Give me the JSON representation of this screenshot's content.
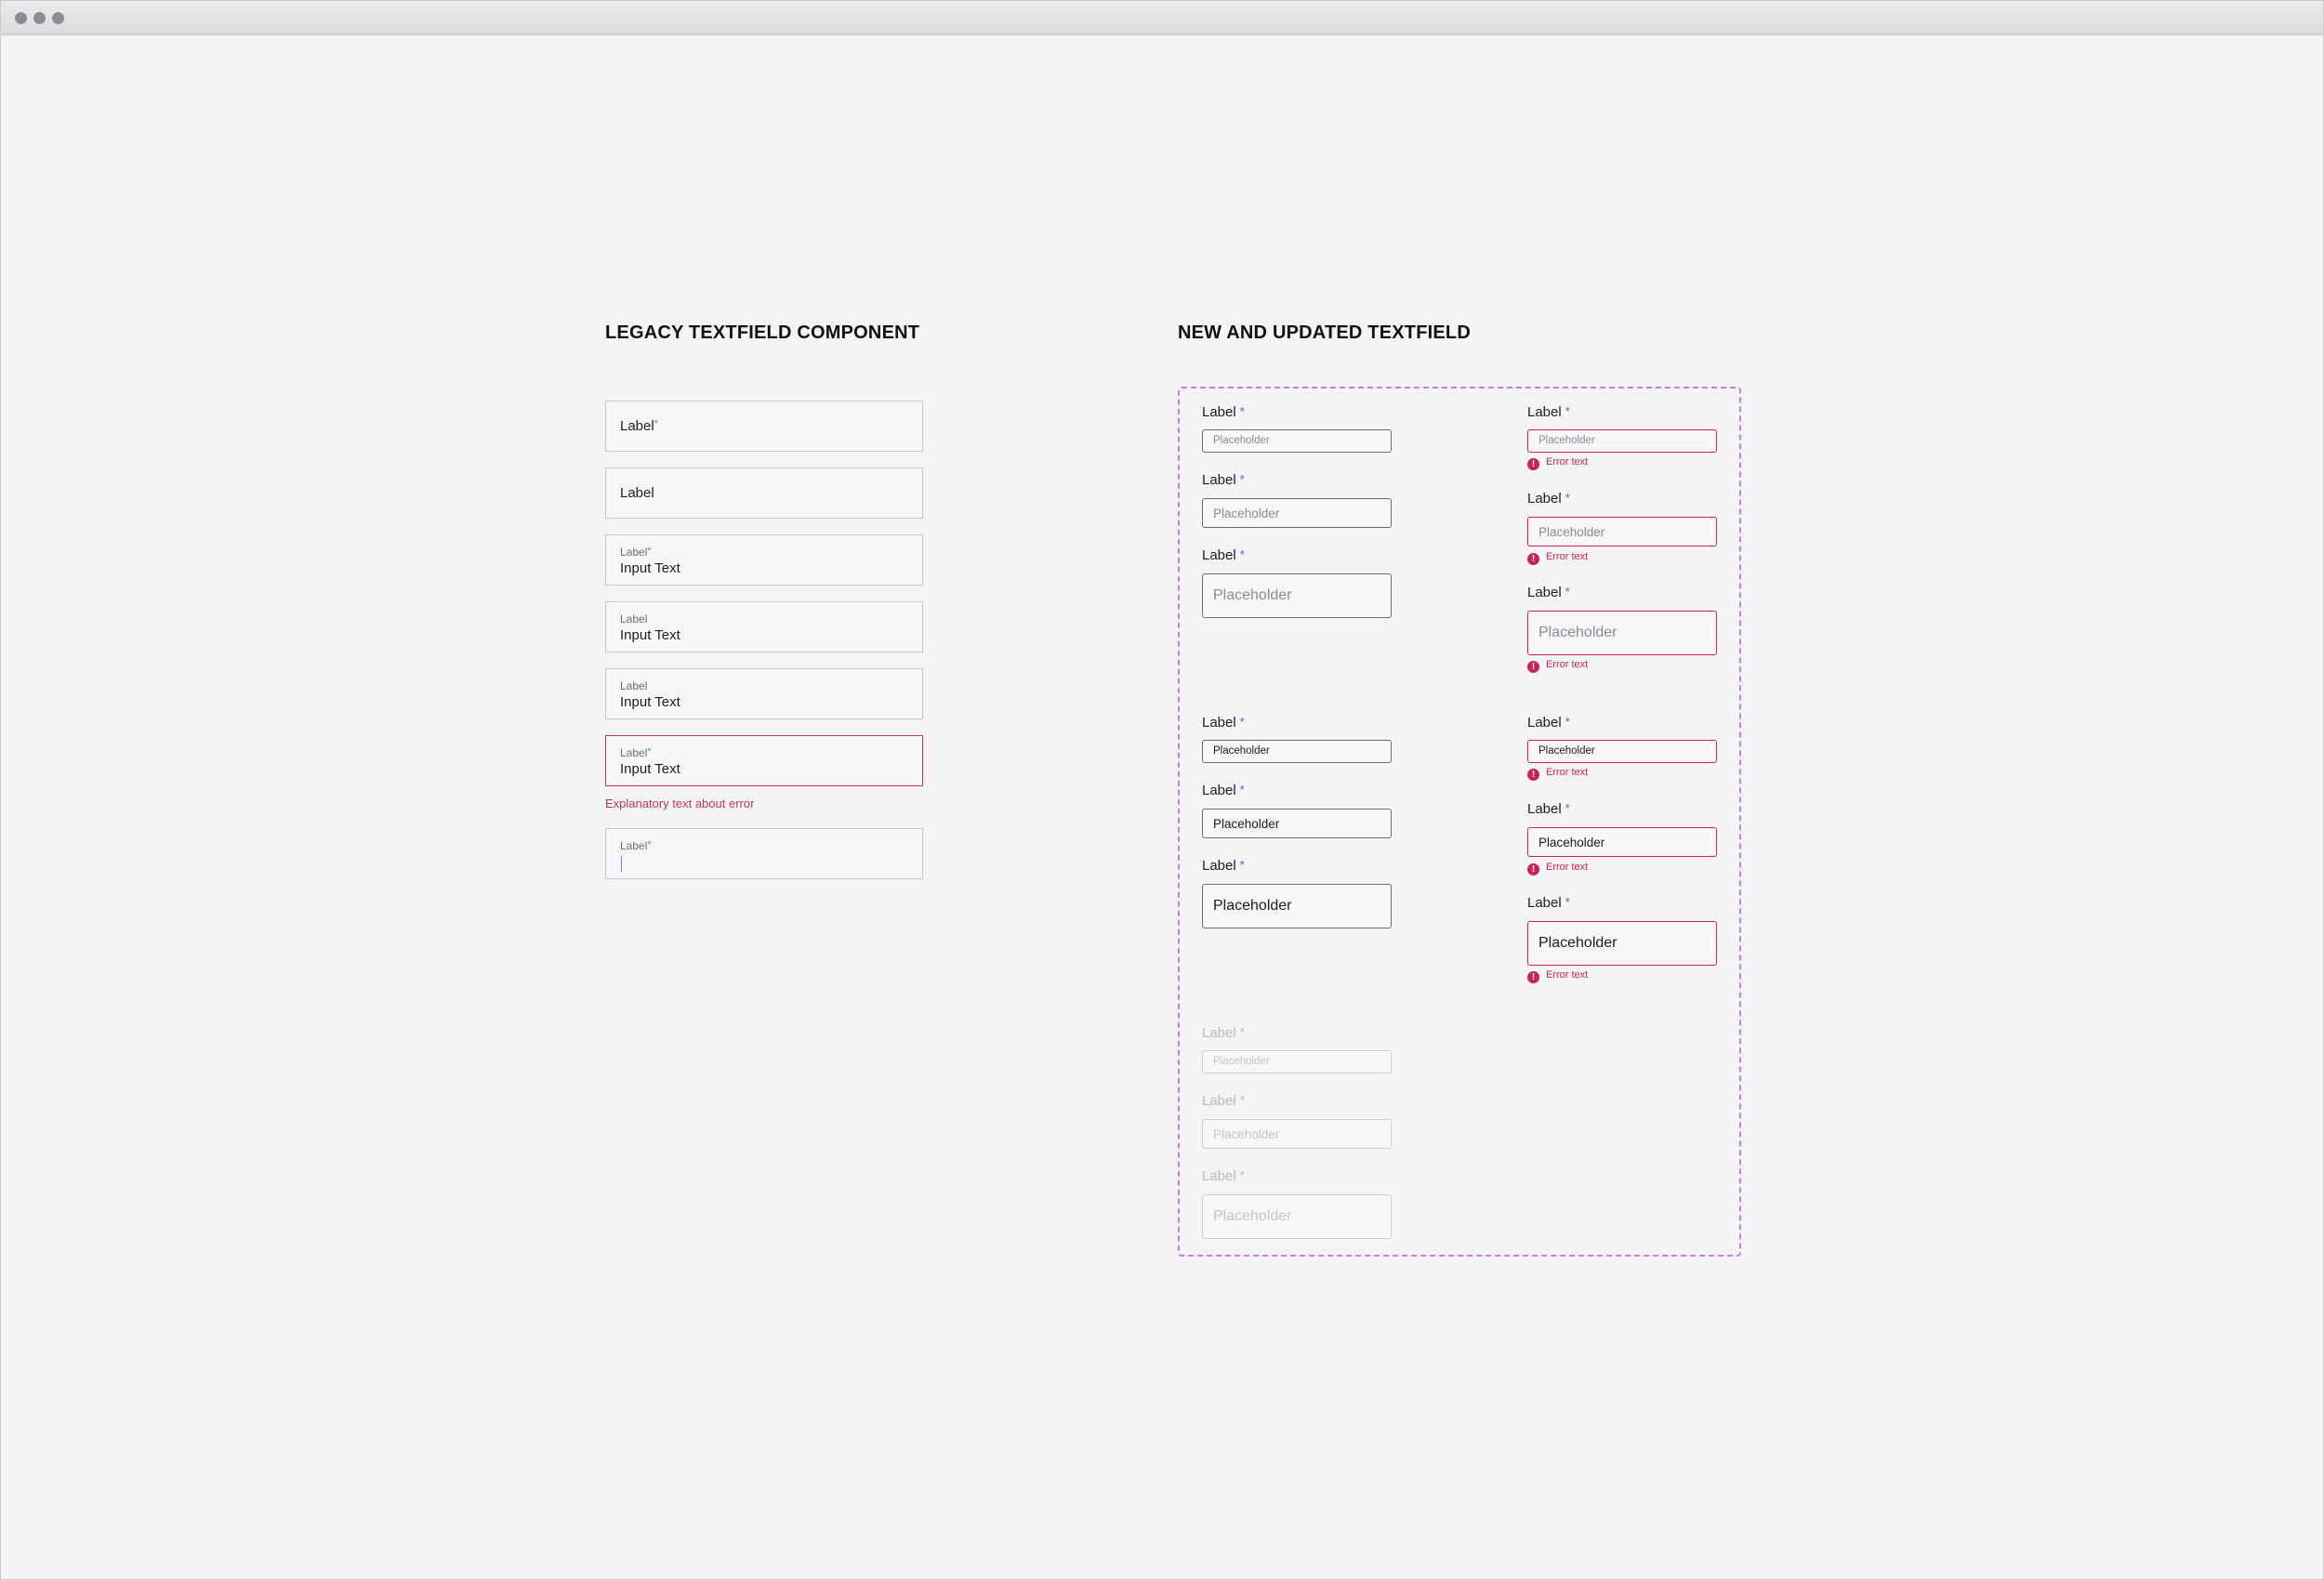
{
  "legacy": {
    "title": "LEGACY TEXTFIELD COMPONENT",
    "fields": [
      {
        "label": "Label",
        "required": "*"
      },
      {
        "label": "Label"
      },
      {
        "label": "Label",
        "required": "*",
        "value": "Input Text"
      },
      {
        "label": "Label",
        "value": "Input Text"
      },
      {
        "label": "Label",
        "value": "Input Text"
      },
      {
        "label": "Label",
        "required": "*",
        "value": "Input Text"
      },
      {
        "label": "Label",
        "required": "*"
      }
    ],
    "error_text": "Explanatory text about error"
  },
  "new": {
    "title": "NEW AND UPDATED TEXTFIELD",
    "label": "Label",
    "required": "*",
    "placeholder": "Placeholder",
    "error_text": "Error text",
    "error_icon": "!"
  },
  "colors": {
    "error": "#c8244f",
    "legacy_required": "#36a3a3",
    "new_required": "#2b6fd6",
    "container_border": "#c77fd6"
  }
}
